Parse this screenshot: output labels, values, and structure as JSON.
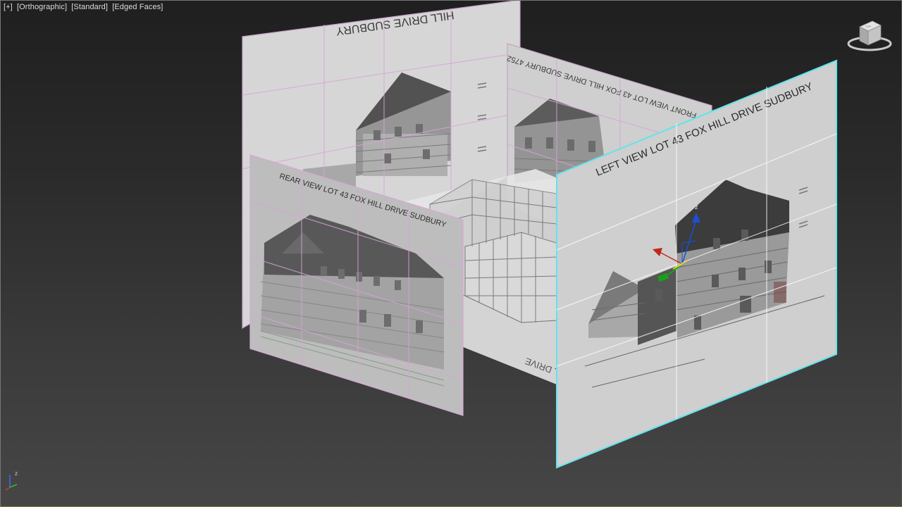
{
  "viewport": {
    "labels": [
      "[+]",
      "[Orthographic]",
      "[Standard]",
      "[Edged Faces]"
    ]
  },
  "panels": {
    "back_left_title": "HILL DRIVE SUDBURY",
    "front_title": "FRONT VIEW LOT 43 FOX HILL DRIVE SUDBURY 4752",
    "rear_title": "REAR VIEW LOT 43 FOX HILL DRIVE SUDBURY",
    "left_title": "LEFT VIEW LOT 43 FOX HILL DRIVE SUDBURY",
    "floor_text": "HILL DRIVE"
  },
  "gizmo": {
    "z_label": "z"
  },
  "viewcube": {
    "face_label": "TOP"
  },
  "tripod": {
    "z_label": "z"
  },
  "colors": {
    "panel_edge": "#d9a6d9",
    "selection": "#5fe4ec",
    "x_axis": "#c0281b",
    "y_axis": "#18a018",
    "z_axis": "#1d4fd6"
  }
}
